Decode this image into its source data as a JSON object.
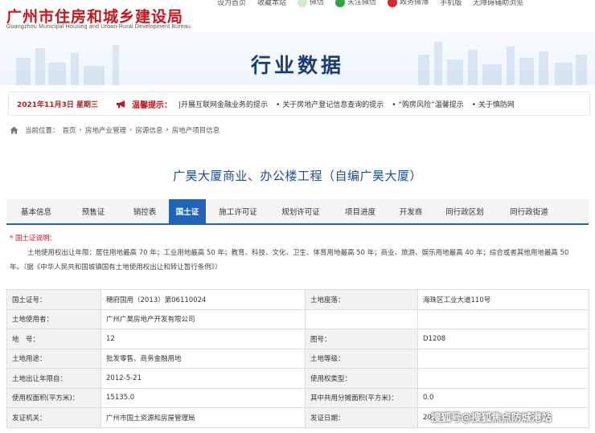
{
  "header": {
    "logo_cn": "广州市住房和城乡建设局",
    "logo_en": "Guangzhou Municipal Housing and Urban-Rural Development Bureau",
    "toplinks": [
      "设为首页",
      "收藏本站",
      "微信",
      "关注微信",
      "政务微博",
      "手机版",
      "无障碍辅助浏览"
    ],
    "page_heading": "行业数据"
  },
  "noticebar": {
    "date": "2021年11月3日 星期三",
    "alert_label": "温馨提示：",
    "items": [
      "|开展互联网金融业务的提示",
      "• 关于房地产登记信息查询的提示",
      "• “购房风险”温馨提示",
      "• 关于慎防网"
    ]
  },
  "breadcrumb": {
    "prefix": "当前位置：",
    "items": [
      "首页",
      "›",
      "房地产业管理",
      "›",
      "房源信息",
      "›",
      "房地产项目信息"
    ]
  },
  "project": {
    "title": "广昊大厦商业、办公楼工程（自编广昊大厦）"
  },
  "tabs": [
    {
      "label": "基本信息",
      "active": false
    },
    {
      "label": "预售证",
      "active": false
    },
    {
      "label": "销控表",
      "active": false
    },
    {
      "label": "国土证",
      "active": true
    },
    {
      "label": "施工许可证",
      "active": false
    },
    {
      "label": "规划许可证",
      "active": false
    },
    {
      "label": "项目进度",
      "active": false
    },
    {
      "label": "开发商",
      "active": false
    },
    {
      "label": "同行政区划",
      "active": false
    },
    {
      "label": "同行政街道",
      "active": false
    }
  ],
  "land_notice": {
    "title": "* 国土证说明：",
    "line1": "土地使用权出让年限：居住用地最高 70 年；工业用地最高 50 年；教育、科技、文化、卫生、体育用地最高 50 年；商业、旅游、娱乐用地最高 40 年；综合或者其他用地最高 50",
    "line2": "年。（据《中华人民共和国城镇国有土地使用权出让和转让暂行条例》）"
  },
  "land_table": {
    "rows": [
      [
        "国土证号：",
        "穗府国用（2013）第06110024",
        "土地座落：",
        "海珠区工业大道110号"
      ],
      [
        "土地使用者：",
        "广州广昊房地产开发有限公司",
        "",
        ""
      ],
      [
        "地　号：",
        "12",
        "图号：",
        "D1208"
      ],
      [
        "土地用途：",
        "批发零售、商务金融用地",
        "土地等级：",
        ""
      ],
      [
        "土地出让年限自：",
        "2012-5-21",
        "使用权类型：",
        ""
      ],
      [
        "使用权面积(平方米)：",
        "15135.0",
        "其中共用分摊面积(平方米)：",
        "0.0"
      ],
      [
        "发证机关：",
        "广州市国土资源和房屋管理局",
        "发证日期：",
        "201"
      ]
    ]
  },
  "watermark": "搜狐号@搜狐焦点防城港站",
  "colors": {
    "brand_red": "#c8161d",
    "heading_blue": "#1c3c76",
    "tab_active": "#2264b8",
    "title_blue": "#1e4c9a"
  }
}
